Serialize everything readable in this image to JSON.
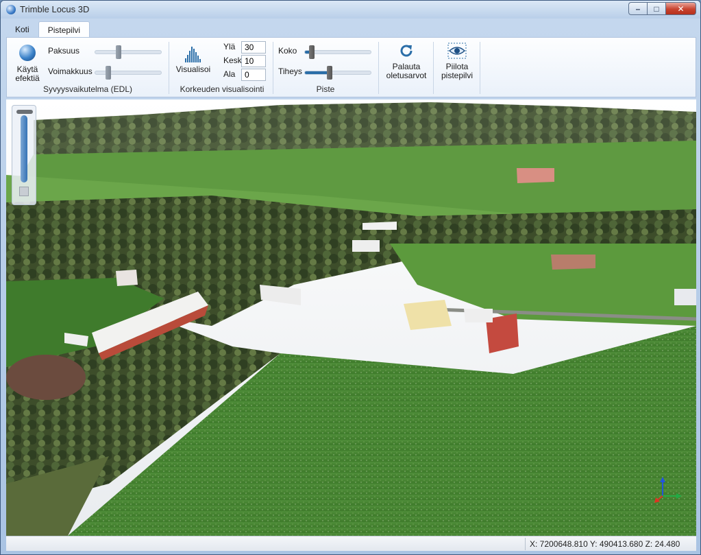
{
  "window": {
    "title": "Trimble Locus 3D"
  },
  "tabs": [
    {
      "label": "Koti",
      "active": false
    },
    {
      "label": "Pistepilvi",
      "active": true
    }
  ],
  "ribbon": {
    "edl": {
      "apply_label_1": "Käytä",
      "apply_label_2": "efektiä",
      "thickness_label": "Paksuus",
      "thickness_level": 0.35,
      "strength_label": "Voimakkuus",
      "strength_level": 0.2,
      "group_label": "Syvyysvaikutelma (EDL)"
    },
    "height": {
      "visualize_label": "Visualisoi",
      "top_label": "Ylä",
      "top_value": "30",
      "mid_label": "Keski",
      "mid_value": "10",
      "bottom_label": "Ala",
      "bottom_value": "0",
      "group_label": "Korkeuden visualisointi"
    },
    "point": {
      "size_label": "Koko",
      "size_level": 0.1,
      "density_label": "Tiheys",
      "density_level": 0.38,
      "group_label": "Piste"
    },
    "reset": {
      "label_1": "Palauta",
      "label_2": "oletusarvot"
    },
    "hide": {
      "label_1": "Piilota",
      "label_2": "pistepilvi"
    }
  },
  "viewport": {
    "zoom_level": 0.92
  },
  "status": {
    "coordinates": "X: 7200648.810  Y: 490413.680  Z: 24.480"
  },
  "colors": {
    "accent": "#2b6ea8",
    "close": "#c8432f",
    "field": "#4a8a32"
  }
}
